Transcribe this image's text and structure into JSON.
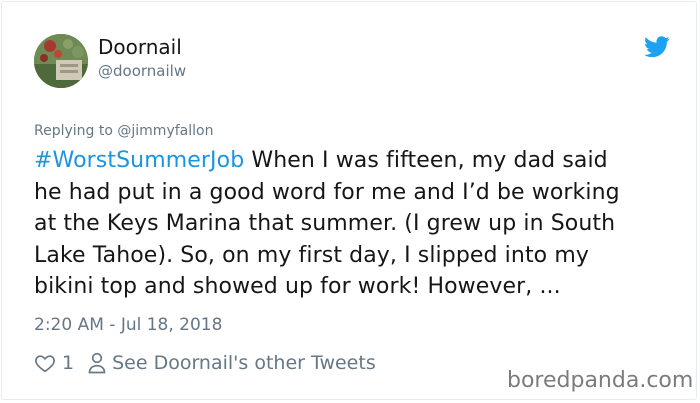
{
  "author": {
    "display_name": "Doornail",
    "handle": "@doornailw"
  },
  "reply": {
    "prefix": "Replying to",
    "mention": "@jimmyfallon"
  },
  "tweet": {
    "hashtag": "#WorstSummerJob",
    "line1": " When I was fifteen, my dad said",
    "line2": "he had put in a good word for me and I’d be working",
    "line3": "at the Keys Marina that summer. (I grew up in South",
    "line4": "Lake Tahoe). So, on my first day, I slipped into my",
    "line5": "bikini top and showed up for work! However, ...",
    "timestamp": "2:20 AM - Jul 18, 2018"
  },
  "actions": {
    "likes": "1",
    "other_tweets": "See Doornail's other Tweets"
  },
  "watermark": "boredpanda.com",
  "colors": {
    "accent": "#1b95e0",
    "twitter_blue": "#1da1f2",
    "muted": "#657786",
    "text": "#14171a"
  },
  "icons": [
    "twitter-bird-icon",
    "heart-icon",
    "person-icon"
  ]
}
